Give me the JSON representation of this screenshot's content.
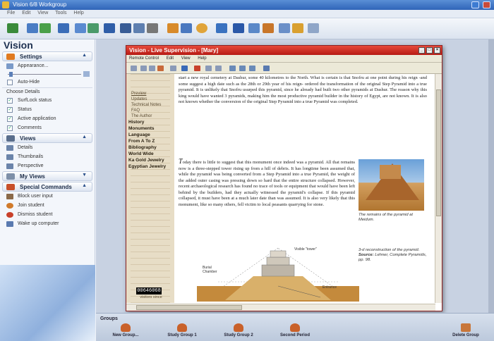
{
  "app": {
    "title": "Vision 6/8 Workgroup",
    "menu": [
      "File",
      "Edit",
      "View",
      "Tools",
      "Help"
    ]
  },
  "sidebar": {
    "title": "Vision",
    "settings": {
      "header": "Settings",
      "appearance": "Appearance...",
      "autohide": "Auto-Hide",
      "choose_details": "Choose Details",
      "details": [
        {
          "label": "SurfLock status",
          "checked": true
        },
        {
          "label": "Status",
          "checked": true
        },
        {
          "label": "Active application",
          "checked": true
        },
        {
          "label": "Comments",
          "checked": true
        }
      ]
    },
    "views": {
      "header": "Views",
      "items": [
        "Details",
        "Thumbnails",
        "Perspective"
      ]
    },
    "my_views": {
      "header": "My Views"
    },
    "special_commands": {
      "header": "Special Commands",
      "items": [
        "Block user input",
        "Join student",
        "Dismiss student",
        "Wake up computer"
      ]
    }
  },
  "viewer": {
    "title": "Vision - Live Supervision - [Mary]",
    "menu": [
      "Remote Control",
      "Edit",
      "View",
      "Help"
    ],
    "webpage": {
      "nav_small": [
        "Preview",
        "Updates",
        "Technical Notes",
        "FAQ",
        "The Author"
      ],
      "nav_big": [
        "History",
        "Monuments",
        "Language",
        "From A To Z",
        "Bibliography",
        "World Wide",
        "Ka Gold Jewelry",
        "Egyptian Jewelry"
      ],
      "counter": "00646068",
      "counter_caption": "visitors since",
      "paragraph1": "start a new royal cemetery at Dashur, some 40 kilometres to the North. What is certain is that Snofru at one point during his reign -and some suggest a high date such as the 28th or 29th year of his reign- ordered the transformation of the original Step Pyramid into a true pyramid. It is unlikely that Snofru usurped this pyramid, since he already had built two other pyramids at Dashur. The reason why this king would have wanted 3 pyramids, making him the most productive pyramid builder in the history of Egypt, are not known. It is also not known whether the conversion of the original Step Pyramid into a true Pyramid was completed.",
      "paragraph2_cap": "T",
      "paragraph2": "oday there is little to suggest that this monument once indeed was a pyramid. All that remains now is a three-stepped tower rising up from a hill of debris. It has longtime been assumed that, while the pyramid was being converted from a Step Pyramid into a true Pyramid, the weight of the added outer casing was pressing down so hard that the entire structure collapsed. However, recent archaeological research has found no trace of tools or equipment that would have been left behind by the builders, had they actually witnessed the pyramid's collapse. If this pyramid collapsed, it must have been at a much later date than was assumed. It is also very likely that this monument, like so many others, fell victim to local peasants quarrying for stone.",
      "photo_caption": "The remains of the pyramid at Meidum.",
      "diagram_caption": "3-d reconstruction of the pyramid.",
      "source_label": "Source:",
      "source_text": "Lehner, Complete Pyramids, pp. 98.",
      "diagram_labels": {
        "visible": "Visible \"tower\"",
        "burial": "Burial Chamber",
        "entrance": "Entrance"
      }
    }
  },
  "groups": {
    "label": "Groups",
    "items": [
      "New Group...",
      "Study Group 1",
      "Study Group 2",
      "Second Period"
    ],
    "delete": "Delete Group"
  }
}
